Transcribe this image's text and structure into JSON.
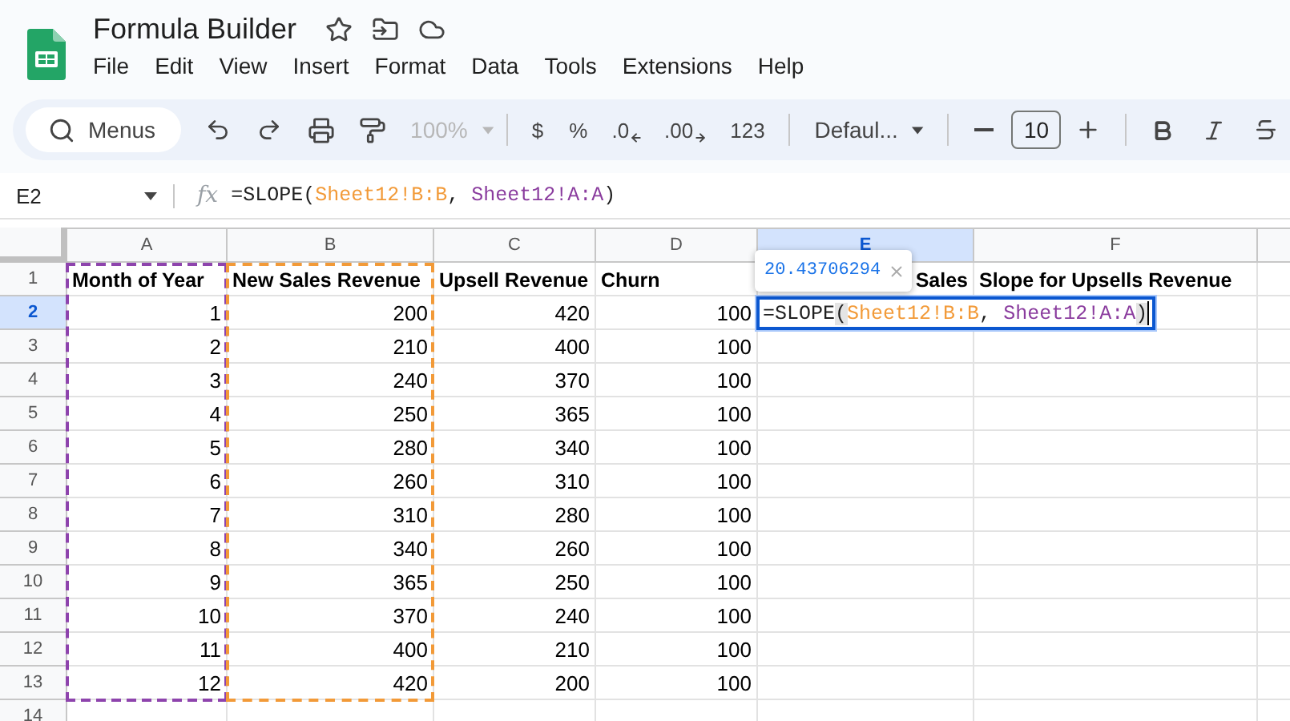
{
  "document": {
    "title": "Formula Builder"
  },
  "menu": [
    "File",
    "Edit",
    "View",
    "Insert",
    "Format",
    "Data",
    "Tools",
    "Extensions",
    "Help"
  ],
  "toolbar": {
    "search": "Menus",
    "zoom": {
      "value": "100%",
      "disabled": true
    },
    "currency": "$",
    "percent": "%",
    "decrease_decimals": ".0",
    "increase_decimals": ".00",
    "number_format": "123",
    "font": "Defaul...",
    "font_size": "10"
  },
  "formula_bar": {
    "cell": "E2",
    "fx": "fx",
    "formula": [
      {
        "text": "=SLOPE("
      },
      {
        "text": "Sheet12!B:B",
        "color": "#f29a38"
      },
      {
        "text": ", "
      },
      {
        "text": "Sheet12!A:A",
        "color": "#8a3c9e"
      },
      {
        "text": ")"
      }
    ]
  },
  "columns": [
    {
      "label": "A",
      "selected": false,
      "color": "#8e44ad"
    },
    {
      "label": "B",
      "selected": false,
      "color": "#f29a38"
    },
    {
      "label": "C",
      "selected": false
    },
    {
      "label": "D",
      "selected": false
    },
    {
      "label": "E",
      "selected": true
    },
    {
      "label": "F",
      "selected": false
    }
  ],
  "rows": [
    {
      "label": "1",
      "selected": false,
      "cells": [
        "Month of Year",
        "New Sales Revenue",
        "Upsell Revenue",
        "Churn",
        "Sales",
        "Slope for Upsells Revenue"
      ]
    },
    {
      "label": "2",
      "selected": true,
      "cells": [
        "1",
        "200",
        "420",
        "100"
      ]
    },
    {
      "label": "3",
      "selected": false,
      "cells": [
        "2",
        "210",
        "400",
        "100"
      ]
    },
    {
      "label": "4",
      "selected": false,
      "cells": [
        "3",
        "240",
        "370",
        "100"
      ]
    },
    {
      "label": "5",
      "selected": false,
      "cells": [
        "4",
        "250",
        "365",
        "100"
      ]
    },
    {
      "label": "6",
      "selected": false,
      "cells": [
        "5",
        "280",
        "340",
        "100"
      ]
    },
    {
      "label": "7",
      "selected": false,
      "cells": [
        "6",
        "260",
        "310",
        "100"
      ]
    },
    {
      "label": "8",
      "selected": false,
      "cells": [
        "7",
        "310",
        "280",
        "100"
      ]
    },
    {
      "label": "9",
      "selected": false,
      "cells": [
        "8",
        "340",
        "260",
        "100"
      ]
    },
    {
      "label": "10",
      "selected": false,
      "cells": [
        "9",
        "365",
        "250",
        "100"
      ]
    },
    {
      "label": "11",
      "selected": false,
      "cells": [
        "10",
        "370",
        "240",
        "100"
      ]
    },
    {
      "label": "12",
      "selected": false,
      "cells": [
        "11",
        "400",
        "210",
        "100"
      ]
    },
    {
      "label": "13",
      "selected": false,
      "cells": [
        "12",
        "420",
        "200",
        "100"
      ]
    },
    {
      "label": "14",
      "selected": false,
      "cells": []
    }
  ],
  "editor": {
    "formula": [
      {
        "text": "=SLOPE"
      },
      {
        "text": "(",
        "matched": true
      },
      {
        "text": "Sheet12!B:B",
        "color": "#f29a38"
      },
      {
        "text": ", "
      },
      {
        "text": "Sheet12!A:A",
        "color": "#8a3c9e"
      },
      {
        "text": ")",
        "matched": true
      }
    ],
    "preview": "20.43706294"
  }
}
